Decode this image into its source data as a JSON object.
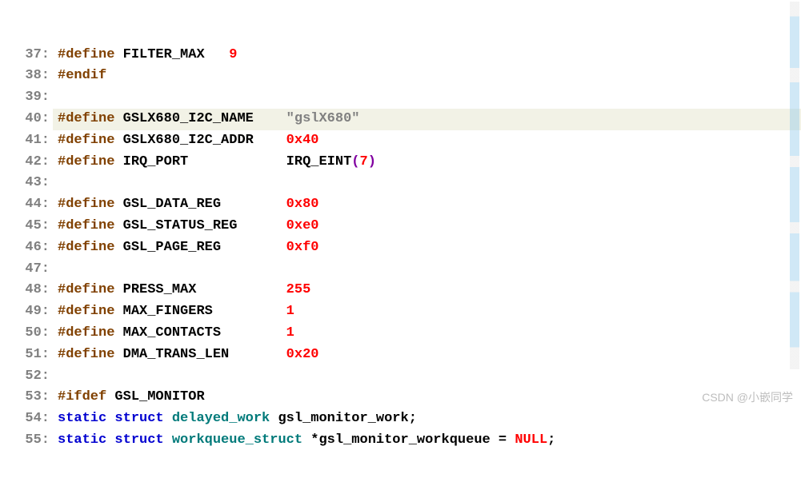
{
  "watermark": "CSDN @小嵌同学",
  "lines": [
    {
      "n": "37:",
      "tokens": [
        [
          "pp",
          "#define "
        ],
        [
          "ident",
          "FILTER_MAX   "
        ],
        [
          "num",
          "9"
        ]
      ]
    },
    {
      "n": "38:",
      "tokens": [
        [
          "pp",
          "#endif"
        ]
      ]
    },
    {
      "n": "39:",
      "tokens": []
    },
    {
      "n": "40:",
      "hl": true,
      "tokens": [
        [
          "pp",
          "#define "
        ],
        [
          "ident",
          "GSLX680_I2C_NAME    "
        ],
        [
          "str",
          "\"gslX680\""
        ]
      ]
    },
    {
      "n": "41:",
      "tokens": [
        [
          "pp",
          "#define "
        ],
        [
          "ident",
          "GSLX680_I2C_ADDR    "
        ],
        [
          "num",
          "0x40"
        ]
      ]
    },
    {
      "n": "42:",
      "tokens": [
        [
          "pp",
          "#define "
        ],
        [
          "ident",
          "IRQ_PORT            "
        ],
        [
          "call",
          "IRQ_EINT"
        ],
        [
          "paren",
          "("
        ],
        [
          "num",
          "7"
        ],
        [
          "paren",
          ")"
        ]
      ]
    },
    {
      "n": "43:",
      "tokens": []
    },
    {
      "n": "44:",
      "tokens": [
        [
          "pp",
          "#define "
        ],
        [
          "ident",
          "GSL_DATA_REG        "
        ],
        [
          "num",
          "0x80"
        ]
      ]
    },
    {
      "n": "45:",
      "tokens": [
        [
          "pp",
          "#define "
        ],
        [
          "ident",
          "GSL_STATUS_REG      "
        ],
        [
          "num",
          "0xe0"
        ]
      ]
    },
    {
      "n": "46:",
      "tokens": [
        [
          "pp",
          "#define "
        ],
        [
          "ident",
          "GSL_PAGE_REG        "
        ],
        [
          "num",
          "0xf0"
        ]
      ]
    },
    {
      "n": "47:",
      "tokens": []
    },
    {
      "n": "48:",
      "tokens": [
        [
          "pp",
          "#define "
        ],
        [
          "ident",
          "PRESS_MAX           "
        ],
        [
          "num",
          "255"
        ]
      ]
    },
    {
      "n": "49:",
      "tokens": [
        [
          "pp",
          "#define "
        ],
        [
          "ident",
          "MAX_FINGERS         "
        ],
        [
          "num",
          "1"
        ]
      ]
    },
    {
      "n": "50:",
      "tokens": [
        [
          "pp",
          "#define "
        ],
        [
          "ident",
          "MAX_CONTACTS        "
        ],
        [
          "num",
          "1"
        ]
      ]
    },
    {
      "n": "51:",
      "tokens": [
        [
          "pp",
          "#define "
        ],
        [
          "ident",
          "DMA_TRANS_LEN       "
        ],
        [
          "num",
          "0x20"
        ]
      ]
    },
    {
      "n": "52:",
      "tokens": []
    },
    {
      "n": "53:",
      "tokens": [
        [
          "pp",
          "#ifdef "
        ],
        [
          "ident",
          "GSL_MONITOR"
        ]
      ]
    },
    {
      "n": "54:",
      "tokens": [
        [
          "kw",
          "static "
        ],
        [
          "kw",
          "struct "
        ],
        [
          "type",
          "delayed_work "
        ],
        [
          "var",
          "gsl_monitor_work"
        ],
        [
          "semi",
          ";"
        ]
      ]
    },
    {
      "n": "55:",
      "tokens": [
        [
          "kw",
          "static "
        ],
        [
          "kw",
          "struct "
        ],
        [
          "type",
          "workqueue_struct "
        ],
        [
          "op",
          "*"
        ],
        [
          "var",
          "gsl_monitor_workqueue"
        ],
        [
          "op",
          " = "
        ],
        [
          "num",
          "NULL"
        ],
        [
          "semi",
          ";"
        ]
      ]
    }
  ]
}
